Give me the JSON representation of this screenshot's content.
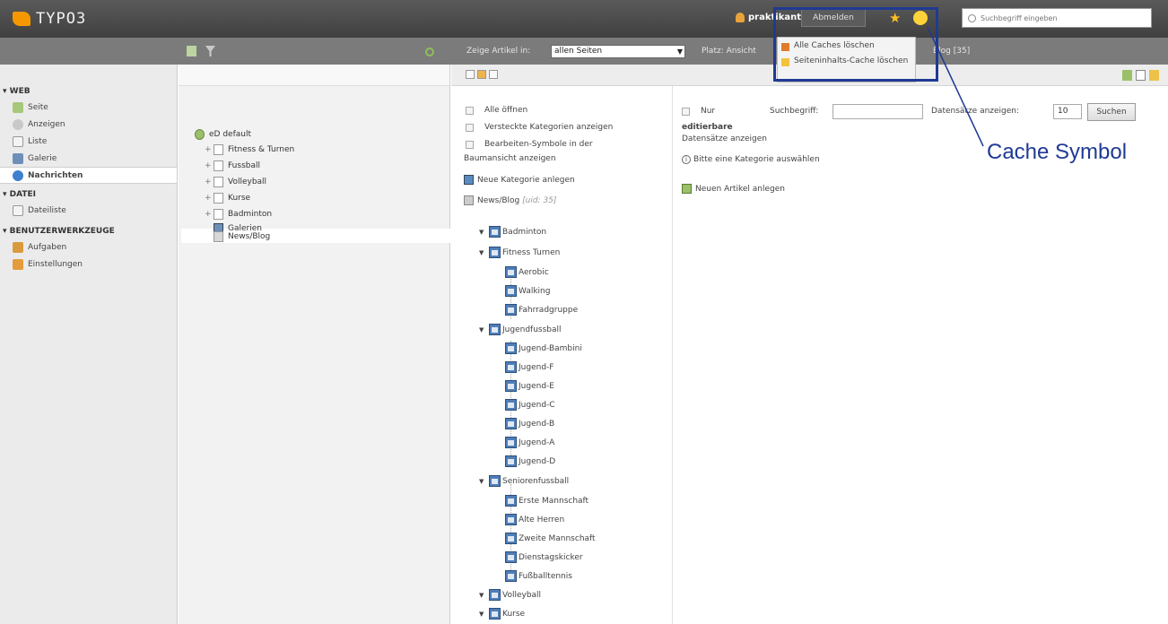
{
  "topbar": {
    "logo_text": "TYPO3",
    "user_name": "praktikant",
    "logout_label": "Abmelden",
    "search_placeholder": "Suchbegriff eingeben"
  },
  "cache_menu": {
    "clear_all_label": "Alle Caches löschen",
    "clear_page_label": "Seiteninhalts-Cache löschen"
  },
  "annotation": {
    "label": "Cache Symbol",
    "color": "#1f3a93"
  },
  "subbar": {
    "articles_label": "Zeige Artikel in:",
    "articles_select": "allen Seiten",
    "platz_label": "Platz: Ansicht",
    "blog_count": "Blog [35]"
  },
  "modules": {
    "web": {
      "title": "WEB",
      "items": [
        "Seite",
        "Anzeigen",
        "Liste",
        "Galerie",
        "Nachrichten"
      ]
    },
    "dateien": {
      "title": "DATEI",
      "items": [
        "Dateiliste"
      ]
    },
    "tools": {
      "title": "BENUTZERWERKZEUGE",
      "items": [
        "Aufgaben",
        "Einstellungen"
      ]
    }
  },
  "pagetree": {
    "root": "eD default",
    "pages": [
      "Fitness & Turnen",
      "Fussball",
      "Volleyball",
      "Kurse",
      "Badminton",
      "Galerien",
      "News/Blog"
    ]
  },
  "content": {
    "checkbox_open_all": "Alle öffnen",
    "checkbox_hidden_categories": "Versteckte Kategorien anzeigen",
    "checkbox_edit_symbols": "Bearbeiten-Symbole in der",
    "tree_view_label": "Baumansicht anzeigen",
    "new_category_label": "Neue Kategorie anlegen",
    "news_blog_label": "News/Blog",
    "news_blog_uid": "[uid: 35]",
    "only_editable_label": "Nur",
    "editable_records_1": "editierbare",
    "editable_records_2": "Datensätze anzeigen",
    "select_category_hint": "Bitte eine Kategorie auswählen",
    "new_article_label": "Neuen Artikel anlegen",
    "search_label": "Suchbegriff:",
    "show_records_label": "Datensätze anzeigen:",
    "records_value": "10",
    "search_button": "Suchen"
  },
  "categories": {
    "badminton": "Badminton",
    "fitness": "Fitness Turnen",
    "fitness_children": [
      "Aerobic",
      "Walking",
      "Fahrradgruppe"
    ],
    "jugend": "Jugendfussball",
    "jugend_children": [
      "Jugend-Bambini",
      "Jugend-F",
      "Jugend-E",
      "Jugend-C",
      "Jugend-B",
      "Jugend-A",
      "Jugend-D"
    ],
    "senioren": "Seniorenfussball",
    "senioren_children": [
      "Erste Mannschaft",
      "Alte Herren",
      "Zweite Mannschaft",
      "Dienstagskicker",
      "Fußballtennis"
    ],
    "volleyball": "Volleyball",
    "kurse": "Kurse"
  }
}
